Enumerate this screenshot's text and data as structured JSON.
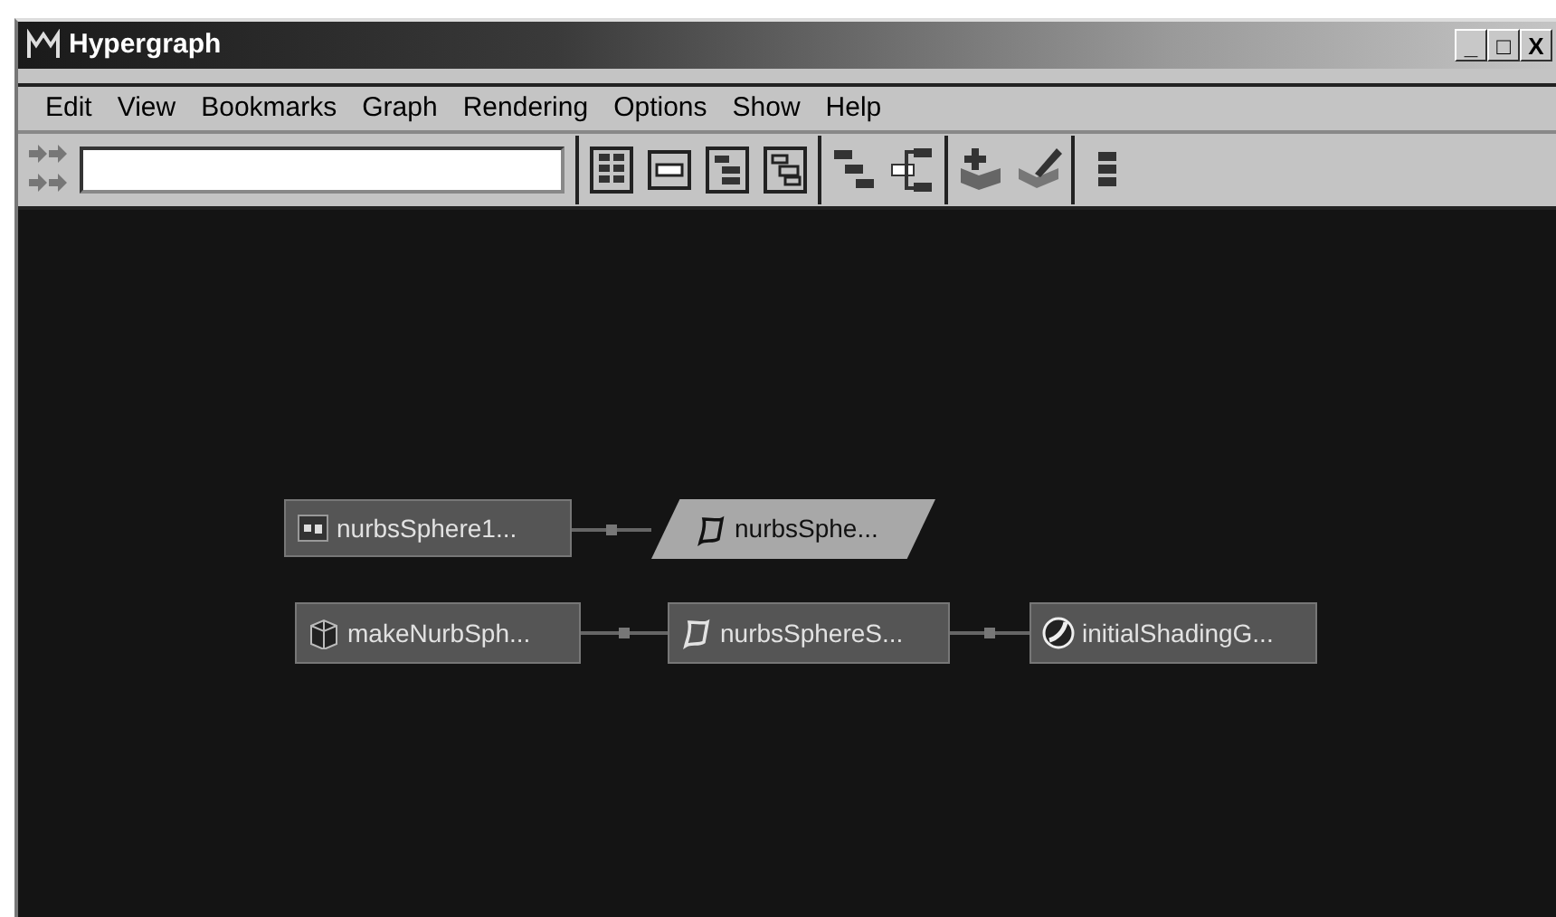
{
  "window": {
    "title": "Hypergraph",
    "controls": [
      "_",
      "□",
      "X"
    ]
  },
  "menu": [
    "Edit",
    "View",
    "Bookmarks",
    "Graph",
    "Rendering",
    "Options",
    "Show",
    "Help"
  ],
  "nodes": [
    {
      "label": "nurbsSphere1...",
      "kind": "transform",
      "selected": false,
      "intermediate": false
    },
    {
      "label": "nurbsSphe...",
      "kind": "shape",
      "selected": true,
      "intermediate": true
    },
    {
      "label": "makeNurbSph...",
      "kind": "history",
      "selected": false,
      "intermediate": false
    },
    {
      "label": "nurbsSphereS...",
      "kind": "shape",
      "selected": false,
      "intermediate": false
    },
    {
      "label": "initialShadingG...",
      "kind": "shading",
      "selected": false,
      "intermediate": false
    }
  ]
}
